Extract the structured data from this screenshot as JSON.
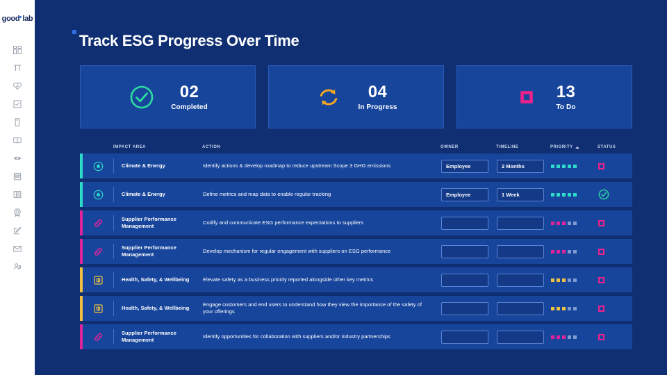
{
  "brand": {
    "name_a": "good",
    "name_b": "lab"
  },
  "sidebar": {
    "items": [
      {
        "icon": "dashboard-grid-icon",
        "label": "Dashboard"
      },
      {
        "icon": "bar-columns-icon",
        "label": "Metrics"
      },
      {
        "icon": "heart-check-icon",
        "label": "Impact"
      },
      {
        "icon": "checkbox-icon",
        "label": "Tasks"
      },
      {
        "icon": "document-icon",
        "label": "Reports"
      },
      {
        "icon": "book-icon",
        "label": "Library"
      },
      {
        "icon": "eye-lens-icon",
        "label": "Insights"
      },
      {
        "icon": "calendar-icon",
        "label": "Calendar"
      },
      {
        "icon": "list-table-icon",
        "label": "Data"
      },
      {
        "icon": "target-badge-icon",
        "label": "Goals"
      },
      {
        "icon": "edit-note-icon",
        "label": "Notes"
      },
      {
        "icon": "mail-envelope-icon",
        "label": "Messages"
      },
      {
        "icon": "users-group-icon",
        "label": "Team"
      }
    ]
  },
  "header": {
    "title": "Track ESG Progress Over Time"
  },
  "cards": [
    {
      "icon": "check-circle-icon",
      "value": "02",
      "label": "Completed",
      "color": "#2ddba0"
    },
    {
      "icon": "refresh-circle-icon",
      "value": "04",
      "label": "In Progress",
      "color": "#f5a623"
    },
    {
      "icon": "square-outline-icon",
      "value": "13",
      "label": "To Do",
      "color": "#f0218b"
    }
  ],
  "table": {
    "columns": {
      "impact_area": "IMPACT AREA",
      "action": "ACTION",
      "owner": "OWNER",
      "timeline": "TIMELINE",
      "priority": "PRIORITY",
      "status": "STATUS"
    },
    "sort": {
      "column": "PRIORITY",
      "direction": "asc"
    },
    "owner_placeholder": "",
    "timeline_placeholder": "",
    "rows": [
      {
        "bar_color": "#2ddbc8",
        "icon": "arrow-down-circle-icon",
        "icon_color": "#2ddbc8",
        "impact_area": "Climate & Energy",
        "action": "Identify actions & develop roadmap to reduce upstream Scope 3 GHG emissions",
        "owner": "Employee",
        "timeline": "2 Months",
        "priority_filled": 5,
        "priority_total": 5,
        "priority_color": "#2ddbc8",
        "status": "todo"
      },
      {
        "bar_color": "#2ddbc8",
        "icon": "arrow-down-circle-icon",
        "icon_color": "#2ddbc8",
        "impact_area": "Climate & Energy",
        "action": "Define metrics and map data to enable regular tracking",
        "owner": "Employee",
        "timeline": "1 Week",
        "priority_filled": 5,
        "priority_total": 5,
        "priority_color": "#2ddbc8",
        "status": "done"
      },
      {
        "bar_color": "#e0239b",
        "icon": "link-chain-icon",
        "icon_color": "#e0239b",
        "impact_area": "Supplier Performance Management",
        "action": "Codify and communicate ESG performance expectations to suppliers",
        "owner": "",
        "timeline": "",
        "priority_filled": 3,
        "priority_total": 5,
        "priority_color": "#e0239b",
        "status": "todo"
      },
      {
        "bar_color": "#e0239b",
        "icon": "link-chain-icon",
        "icon_color": "#e0239b",
        "impact_area": "Supplier Performance Management",
        "action": "Develop mechanism for regular engagement with suppliers on ESG performance",
        "owner": "",
        "timeline": "",
        "priority_filled": 3,
        "priority_total": 5,
        "priority_color": "#e0239b",
        "status": "todo"
      },
      {
        "bar_color": "#f0c040",
        "icon": "safety-box-icon",
        "icon_color": "#f0c040",
        "impact_area": "Health, Safety, & Wellbeing",
        "action": "Elevate safety as a business priority reported alongside other key metrics",
        "owner": "",
        "timeline": "",
        "priority_filled": 3,
        "priority_total": 5,
        "priority_color": "#f0c040",
        "status": "todo"
      },
      {
        "bar_color": "#f0c040",
        "icon": "safety-box-icon",
        "icon_color": "#f0c040",
        "impact_area": "Health, Safety, & Wellbeing",
        "action": "Engage customers and end users to understand how they view the importance of the safety of your offerings",
        "owner": "",
        "timeline": "",
        "priority_filled": 3,
        "priority_total": 5,
        "priority_color": "#f0c040",
        "status": "todo"
      },
      {
        "bar_color": "#e0239b",
        "icon": "link-chain-icon",
        "icon_color": "#e0239b",
        "impact_area": "Supplier Performance Management",
        "action": "Identify opportunities for collaboration with suppliers and/or industry partnerships",
        "owner": "",
        "timeline": "",
        "priority_filled": 3,
        "priority_total": 5,
        "priority_color": "#e0239b",
        "status": "todo"
      }
    ]
  },
  "colors": {
    "page_bg": "#0f2f72",
    "card_bg": "#17459c",
    "accent_teal": "#2ddbc8",
    "accent_green": "#2ddba0",
    "accent_amber": "#f5a623",
    "accent_pink": "#f0218b",
    "sidebar_bg": "#ffffff"
  }
}
